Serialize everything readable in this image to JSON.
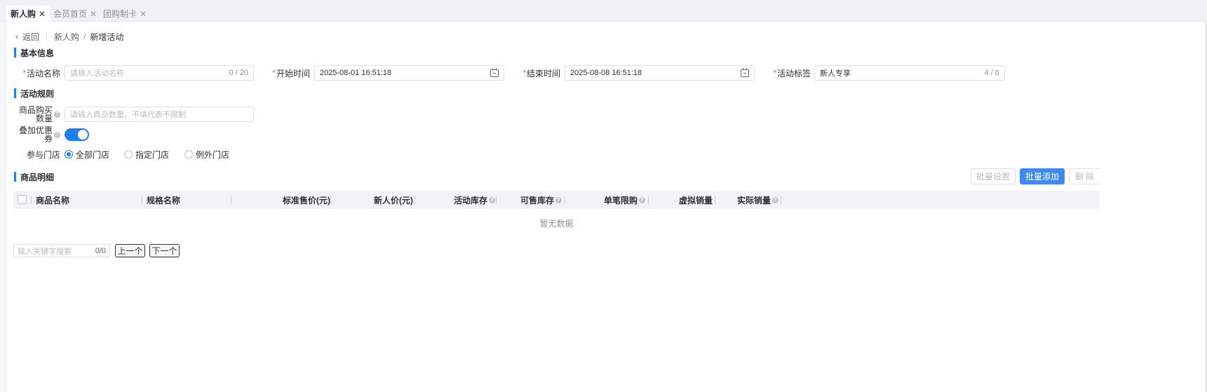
{
  "tabs": [
    {
      "label": "新人购",
      "active": true
    },
    {
      "label": "会员首页",
      "active": false
    },
    {
      "label": "团购制卡",
      "active": false
    }
  ],
  "breadcrumb": {
    "back": "返回",
    "parent": "新人购",
    "separator": "/",
    "current": "新增活动"
  },
  "sections": {
    "basic": "基本信息",
    "rules": "活动规则",
    "goods": "商品明细"
  },
  "basic": {
    "name": {
      "label": "活动名称",
      "placeholder": "请输入活动名称",
      "count": "0 / 20"
    },
    "start": {
      "label": "开始时间",
      "value": "2025-08-01 16:51:18"
    },
    "end": {
      "label": "结束时间",
      "value": "2025-08-08 16:51:18"
    },
    "tag": {
      "label": "活动标签",
      "value": "新人专享",
      "count": "4 / 6"
    }
  },
  "rules": {
    "qty": {
      "label_line1": "商品购买",
      "label_line2": "数量",
      "placeholder": "请输入商品数量，不填代表不限制"
    },
    "coupon": {
      "label_line1": "叠加优惠",
      "label_line2": "券",
      "enabled": true
    },
    "stores": {
      "label": "参与门店",
      "options": [
        "全部门店",
        "指定门店",
        "例外门店"
      ],
      "selected": "全部门店"
    }
  },
  "goods": {
    "buttons": {
      "batch_set": "批量设置",
      "batch_add": "批量添加",
      "delete": "删 除"
    },
    "columns": [
      "商品名称",
      "规格名称",
      "标准售价(元)",
      "新人价(元)",
      "活动库存",
      "可售库存",
      "单笔限购",
      "虚拟销量",
      "实际销量"
    ],
    "empty_text": "暂无数据"
  },
  "search": {
    "placeholder": "输入关键字搜索",
    "count": "0/0",
    "prev": "上一个",
    "next": "下一个"
  },
  "colors": {
    "primary": "#1f7ef0",
    "required": "#f56c6c"
  }
}
